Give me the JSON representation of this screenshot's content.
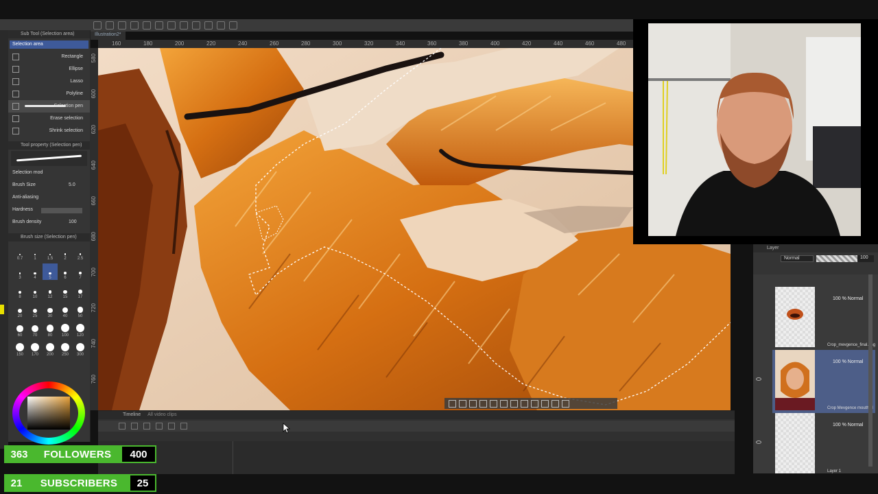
{
  "toolbar": {
    "doc_tab": "Illustration2*"
  },
  "sub_tool_panel": {
    "title": "Sub Tool (Selection area)",
    "group_label": "Selection area",
    "tools": [
      {
        "label": "Rectangle",
        "icon": "rectangle-icon",
        "active": false
      },
      {
        "label": "Ellipse",
        "icon": "ellipse-icon",
        "active": false
      },
      {
        "label": "Lasso",
        "icon": "lasso-icon",
        "active": false
      },
      {
        "label": "Polyline",
        "icon": "polyline-icon",
        "active": false
      },
      {
        "label": "Selection pen",
        "icon": "selection-pen-icon",
        "active": true
      },
      {
        "label": "Erase selection",
        "icon": "erase-selection-icon",
        "active": false
      },
      {
        "label": "Shrink selection",
        "icon": "shrink-selection-icon",
        "active": false
      }
    ]
  },
  "tool_property": {
    "title": "Tool property (Selection pen)",
    "preview_label": "Selection pen",
    "selection_mode_label": "Selection mod",
    "brush_size_label": "Brush Size",
    "brush_size_value": "5.0",
    "anti_aliasing_label": "Anti-aliasing",
    "hardness_label": "Hardness",
    "brush_density_label": "Brush density",
    "brush_density_value": "100"
  },
  "brush_size_panel": {
    "title": "Brush size (Selection pen)",
    "sizes": [
      "0.7",
      "1",
      "1.5",
      "2",
      "2.5",
      "3",
      "4",
      "5",
      "6",
      "7",
      "8",
      "10",
      "12",
      "15",
      "17",
      "20",
      "25",
      "30",
      "40",
      "50",
      "60",
      "70",
      "80",
      "100",
      "120",
      "150",
      "170",
      "200",
      "250",
      "300"
    ],
    "selected": "5"
  },
  "ruler": {
    "top": [
      "160",
      "180",
      "200",
      "220",
      "240",
      "260",
      "280",
      "300",
      "320",
      "340",
      "360",
      "380",
      "400",
      "420",
      "440",
      "460",
      "480"
    ],
    "left": [
      "580",
      "600",
      "620",
      "640",
      "660",
      "680",
      "700",
      "720",
      "740",
      "760"
    ]
  },
  "timeline": {
    "title": "Timeline",
    "frame_label": "All video clips"
  },
  "layer_panel": {
    "title": "Layer",
    "blend_mode": "Normal",
    "opacity": "100",
    "opacity_fraction": 1.0,
    "layers": [
      {
        "mode": "100 % Normal",
        "name": "Crop_mevgence_final.png",
        "active": false,
        "visible": false
      },
      {
        "mode": "100 % Normal",
        "name": "Crop Mevgence mouth cl",
        "active": true,
        "visible": true
      },
      {
        "mode": "100 % Normal",
        "name": "Layer 1",
        "active": false,
        "visible": true
      }
    ]
  },
  "overlays": {
    "followers": {
      "current": "363",
      "label": "FOLLOWERS",
      "goal": "400"
    },
    "subscribers": {
      "current": "21",
      "label": "SUBSCRIBERS",
      "goal": "25"
    }
  },
  "colors": {
    "accent_green": "#4ab82e",
    "selection_blue": "#3e5a9a",
    "fur_orange": "#d9781c"
  }
}
